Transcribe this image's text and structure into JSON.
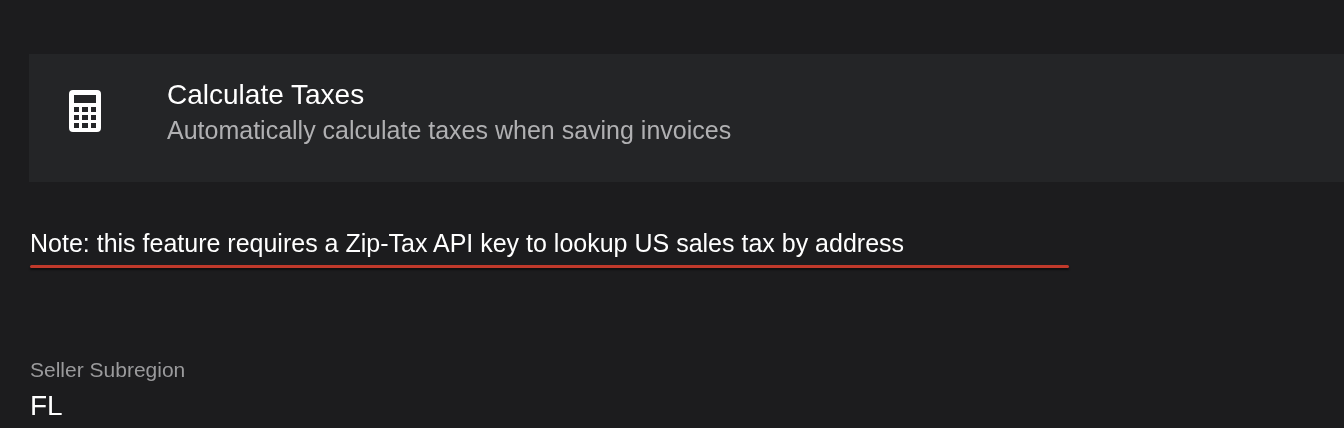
{
  "setting": {
    "title": "Calculate Taxes",
    "description": "Automatically calculate taxes when saving invoices"
  },
  "note": "Note: this feature requires a Zip-Tax API key to lookup US sales tax by address",
  "field": {
    "label": "Seller Subregion",
    "value": "FL"
  }
}
